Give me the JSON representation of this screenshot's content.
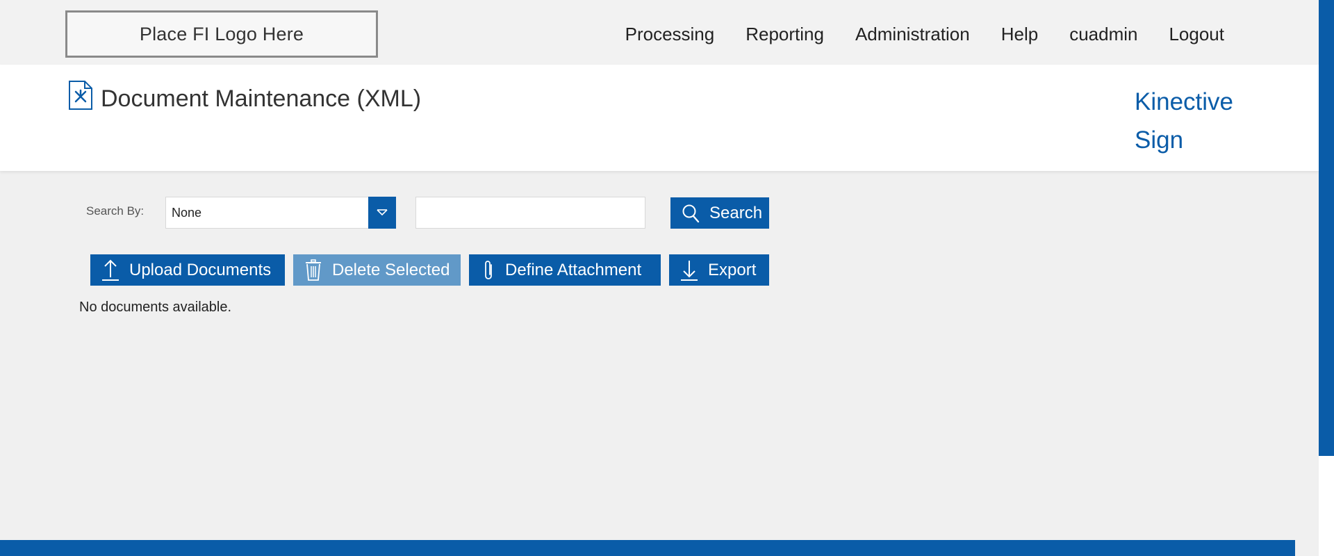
{
  "top": {
    "logo_text": "Place FI Logo Here",
    "nav": [
      "Processing",
      "Reporting",
      "Administration",
      "Help",
      "cuadmin",
      "Logout"
    ]
  },
  "header": {
    "title": "Document Maintenance (XML)",
    "brand": "Kinective Sign",
    "title_icon": "document-settings-icon"
  },
  "search": {
    "label": "Search By:",
    "selected": "None",
    "query_value": "",
    "button_label": "Search"
  },
  "actions": {
    "upload_label": "Upload Documents",
    "delete_label": "Delete Selected",
    "attach_label": "Define Attachment",
    "export_label": "Export"
  },
  "status": {
    "empty_message": "No documents available."
  },
  "colors": {
    "primary": "#0a5ca8",
    "disabled": "#6199c8"
  }
}
